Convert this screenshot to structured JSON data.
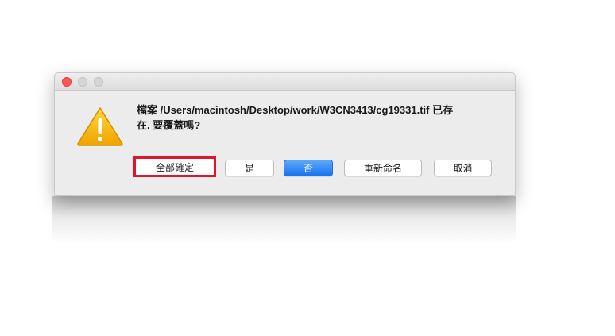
{
  "window": {
    "traffic_lights": [
      "close",
      "minimize",
      "zoom"
    ]
  },
  "dialog": {
    "icon": "warning-icon",
    "message_line1": "檔案 /Users/macintosh/Desktop/work/W3CN3413/cg19331.tif 已存",
    "message_line2": "在. 要覆蓋嗎?",
    "buttons": {
      "replace_all": "全部確定",
      "yes": "是",
      "no": "否",
      "rename": "重新命名",
      "cancel": "取消"
    },
    "highlight_color": "#e0142b",
    "default_button_color": "#1a73ef"
  }
}
